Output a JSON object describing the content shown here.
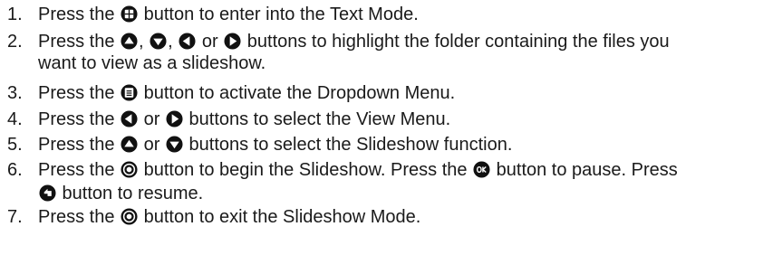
{
  "steps": [
    {
      "number": "1.",
      "lines": [
        [
          "Press the ",
          {
            "icon": "grid-button-icon"
          },
          " button to enter into the Text Mode."
        ]
      ]
    },
    {
      "number": "2.",
      "lines": [
        [
          "Press the ",
          {
            "icon": "up-button-icon"
          },
          ", ",
          {
            "icon": "down-button-icon"
          },
          ", ",
          {
            "icon": "left-button-icon"
          },
          " or ",
          {
            "icon": "right-button-icon"
          },
          " buttons to highlight the folder containing the files you"
        ],
        [
          "want to view as a slideshow."
        ]
      ]
    },
    {
      "number": "3.",
      "lines": [
        [
          "Press the ",
          {
            "icon": "menu-button-icon"
          },
          " button to activate the Dropdown Menu."
        ]
      ]
    },
    {
      "number": "4.",
      "lines": [
        [
          "Press the ",
          {
            "icon": "left-button-icon"
          },
          " or ",
          {
            "icon": "right-button-icon"
          },
          " buttons to select the View Menu."
        ]
      ]
    },
    {
      "number": "5.",
      "lines": [
        [
          "Press the ",
          {
            "icon": "up-button-icon"
          },
          " or ",
          {
            "icon": "down-button-icon"
          },
          " buttons to select the Slideshow function."
        ]
      ]
    },
    {
      "number": "6.",
      "lines": [
        [
          "Press the ",
          {
            "icon": "play-stop-button-icon"
          },
          " button to begin the Slideshow. Press the ",
          {
            "icon": "ok-button-icon"
          },
          " button to pause. Press"
        ],
        [
          {
            "icon": "back-button-icon"
          },
          " button to resume."
        ]
      ]
    },
    {
      "number": "7.",
      "lines": [
        [
          "Press the ",
          {
            "icon": "play-stop-button-icon"
          },
          " button to exit the Slideshow Mode."
        ]
      ]
    }
  ]
}
